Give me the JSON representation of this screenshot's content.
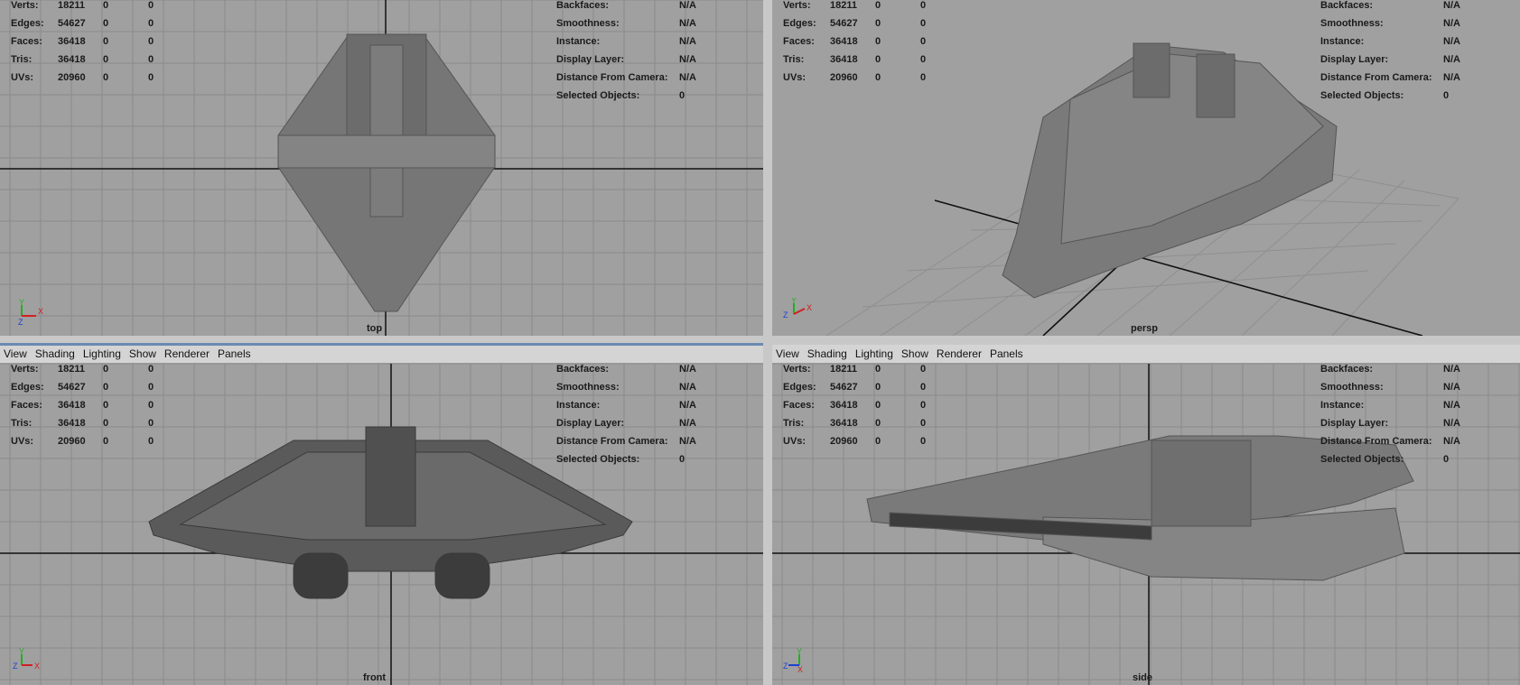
{
  "menu": [
    "View",
    "Shading",
    "Lighting",
    "Show",
    "Renderer",
    "Panels"
  ],
  "hud_left": [
    {
      "key": "Verts:",
      "v1": "18211",
      "v2": "0",
      "v3": "0"
    },
    {
      "key": "Edges:",
      "v1": "54627",
      "v2": "0",
      "v3": "0"
    },
    {
      "key": "Faces:",
      "v1": "36418",
      "v2": "0",
      "v3": "0"
    },
    {
      "key": "Tris:",
      "v1": "36418",
      "v2": "0",
      "v3": "0"
    },
    {
      "key": "UVs:",
      "v1": "20960",
      "v2": "0",
      "v3": "0"
    }
  ],
  "hud_right": [
    {
      "key": "Backfaces:",
      "value": "N/A"
    },
    {
      "key": "Smoothness:",
      "value": "N/A"
    },
    {
      "key": "Instance:",
      "value": "N/A"
    },
    {
      "key": "Display Layer:",
      "value": "N/A"
    },
    {
      "key": "Distance From Camera:",
      "value": "N/A"
    },
    {
      "key": "Selected Objects:",
      "value": "0"
    }
  ],
  "panels": {
    "top": {
      "camera": "top"
    },
    "persp": {
      "camera": "persp"
    },
    "front": {
      "camera": "front"
    },
    "side": {
      "camera": "side"
    }
  },
  "axis_labels": {
    "x": "X",
    "y": "Y",
    "z": "Z"
  },
  "colors": {
    "viewport_bg": "#a0a0a0",
    "grid_line": "#8a8a8a",
    "axis_line": "#111111",
    "model": "#6e6e6e",
    "axis_x": "#d02020",
    "axis_y": "#20b020",
    "axis_z": "#2040d0"
  }
}
